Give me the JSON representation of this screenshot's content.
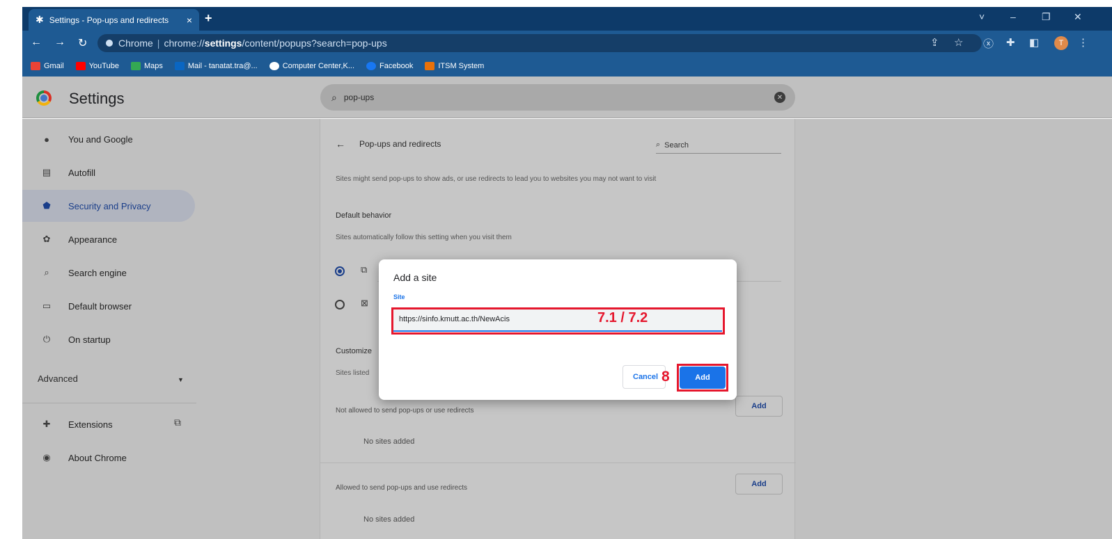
{
  "browser": {
    "tab_title": "Settings - Pop-ups and redirects",
    "tab_close": "×",
    "new_tab": "+",
    "window_controls": [
      "˅",
      "–",
      "❐",
      "✕"
    ],
    "address": {
      "chip": "Chrome",
      "scheme": "chrome://",
      "host": "settings",
      "path": "/content/popups?search=pop-ups"
    },
    "avatar_letter": "T"
  },
  "bookmarks": [
    {
      "label": "Gmail",
      "color": "#ea4335"
    },
    {
      "label": "YouTube",
      "color": "#ff0000"
    },
    {
      "label": "Maps",
      "color": "#34a853"
    },
    {
      "label": "Mail - tanatat.tra@...",
      "color": "#0a66c2"
    },
    {
      "label": "Computer Center,K...",
      "color": "#ffffff"
    },
    {
      "label": "Facebook",
      "color": "#1877f2"
    },
    {
      "label": "ITSM System",
      "color": "#e8710a"
    }
  ],
  "settings": {
    "title": "Settings",
    "search_value": "pop-ups"
  },
  "sidebar": {
    "items": [
      {
        "label": "You and Google",
        "icon": "person-icon"
      },
      {
        "label": "Autofill",
        "icon": "clipboard-icon"
      },
      {
        "label": "Security and Privacy",
        "icon": "shield-icon"
      },
      {
        "label": "Appearance",
        "icon": "palette-icon"
      },
      {
        "label": "Search engine",
        "icon": "search-icon"
      },
      {
        "label": "Default browser",
        "icon": "browser-icon"
      },
      {
        "label": "On startup",
        "icon": "power-icon"
      }
    ],
    "advanced": "Advanced",
    "extensions": "Extensions",
    "about": "About Chrome"
  },
  "page": {
    "title": "Pop-ups and redirects",
    "search_placeholder": "Search",
    "description": "Sites might send pop-ups to show ads, or use redirects to lead you to websites you may not want to visit",
    "default_behavior": "Default behavior",
    "default_sub": "Sites automatically follow this setting when you visit them",
    "customized": "Customize",
    "customized_sub": "Sites listed",
    "not_allowed_label": "Not allowed to send pop-ups or use redirects",
    "allowed_label": "Allowed to send pop-ups and use redirects",
    "no_sites": "No sites added",
    "add_label": "Add"
  },
  "dialog": {
    "title": "Add a site",
    "field_label": "Site",
    "field_value": "https://sinfo.kmutt.ac.th/NewAcis",
    "cancel": "Cancel",
    "add": "Add"
  },
  "annotations": {
    "input_step": "7.1 / 7.2",
    "add_step": "8",
    "color": "#e5172d"
  }
}
